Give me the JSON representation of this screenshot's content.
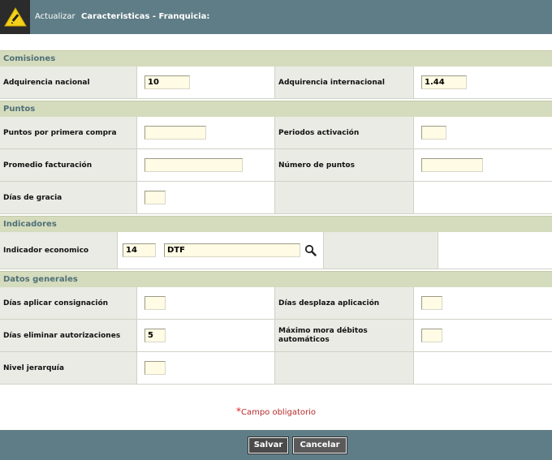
{
  "header": {
    "action": "Actualizar",
    "title": "Caracteristicas - Franquicia:"
  },
  "sections": {
    "comisiones": "Comisiones",
    "puntos": "Puntos",
    "indicadores": "Indicadores",
    "datos_generales": "Datos generales"
  },
  "fields": {
    "adquirencia_nacional": {
      "label": "Adquirencia nacional",
      "value": "10"
    },
    "adquirencia_internacional": {
      "label": "Adquirencia internacional",
      "value": "1.44"
    },
    "puntos_primera_compra": {
      "label": "Puntos por primera compra",
      "value": ""
    },
    "periodos_activacion": {
      "label": "Periodos activación",
      "value": ""
    },
    "promedio_facturacion": {
      "label": "Promedio facturación",
      "value": ""
    },
    "numero_puntos": {
      "label": "Número de puntos",
      "value": ""
    },
    "dias_gracia": {
      "label": "Días de gracia",
      "value": ""
    },
    "indicador_economico": {
      "label": "Indicador economico",
      "code": "14",
      "name": "DTF"
    },
    "dias_aplicar_consignacion": {
      "label": "Días aplicar consignación",
      "value": ""
    },
    "dias_desplaza_aplicacion": {
      "label": "Días desplaza aplicación",
      "value": ""
    },
    "dias_eliminar_autorizaciones": {
      "label": "Días eliminar autorizaciones",
      "value": "5"
    },
    "maximo_mora_debitos": {
      "label_line1": "Máximo mora débitos",
      "label_line2": "automáticos",
      "value": ""
    },
    "nivel_jerarquia": {
      "label": "Nivel jerarquía",
      "value": ""
    }
  },
  "required_note": {
    "star": "*",
    "text": "Campo obligatorio"
  },
  "buttons": {
    "save": "Salvar",
    "cancel": "Cancelar"
  },
  "icons": {
    "logo": "pencil-warning-icon",
    "search": "magnifier-icon"
  },
  "colors": {
    "bar": "#5f7d86",
    "section_bg": "#d5dbbd",
    "section_text": "#4f7078",
    "input_bg": "#fffbe4",
    "required": "#b52a2a"
  }
}
